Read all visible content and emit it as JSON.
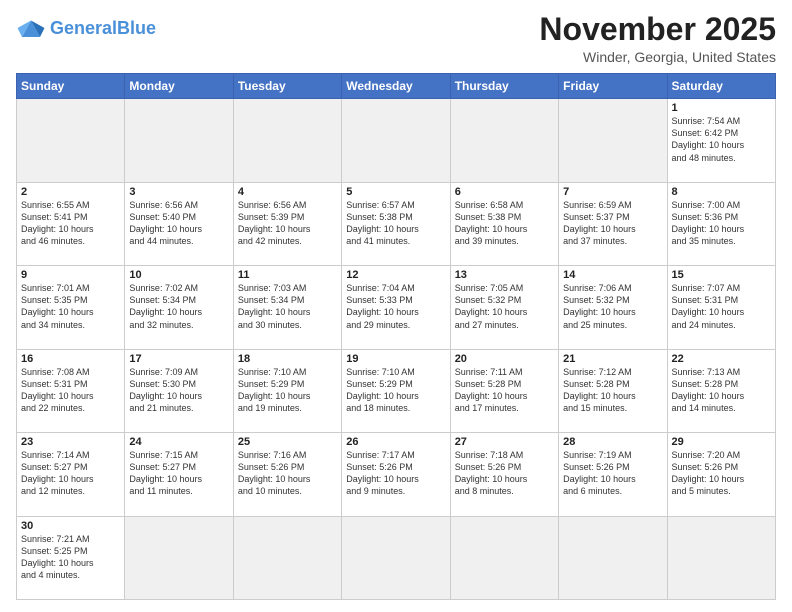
{
  "header": {
    "logo_general": "General",
    "logo_blue": "Blue",
    "month": "November 2025",
    "location": "Winder, Georgia, United States"
  },
  "weekdays": [
    "Sunday",
    "Monday",
    "Tuesday",
    "Wednesday",
    "Thursday",
    "Friday",
    "Saturday"
  ],
  "weeks": [
    [
      {
        "day": "",
        "info": ""
      },
      {
        "day": "",
        "info": ""
      },
      {
        "day": "",
        "info": ""
      },
      {
        "day": "",
        "info": ""
      },
      {
        "day": "",
        "info": ""
      },
      {
        "day": "",
        "info": ""
      },
      {
        "day": "1",
        "info": "Sunrise: 7:54 AM\nSunset: 6:42 PM\nDaylight: 10 hours\nand 48 minutes."
      }
    ],
    [
      {
        "day": "2",
        "info": "Sunrise: 6:55 AM\nSunset: 5:41 PM\nDaylight: 10 hours\nand 46 minutes."
      },
      {
        "day": "3",
        "info": "Sunrise: 6:56 AM\nSunset: 5:40 PM\nDaylight: 10 hours\nand 44 minutes."
      },
      {
        "day": "4",
        "info": "Sunrise: 6:56 AM\nSunset: 5:39 PM\nDaylight: 10 hours\nand 42 minutes."
      },
      {
        "day": "5",
        "info": "Sunrise: 6:57 AM\nSunset: 5:38 PM\nDaylight: 10 hours\nand 41 minutes."
      },
      {
        "day": "6",
        "info": "Sunrise: 6:58 AM\nSunset: 5:38 PM\nDaylight: 10 hours\nand 39 minutes."
      },
      {
        "day": "7",
        "info": "Sunrise: 6:59 AM\nSunset: 5:37 PM\nDaylight: 10 hours\nand 37 minutes."
      },
      {
        "day": "8",
        "info": "Sunrise: 7:00 AM\nSunset: 5:36 PM\nDaylight: 10 hours\nand 35 minutes."
      }
    ],
    [
      {
        "day": "9",
        "info": "Sunrise: 7:01 AM\nSunset: 5:35 PM\nDaylight: 10 hours\nand 34 minutes."
      },
      {
        "day": "10",
        "info": "Sunrise: 7:02 AM\nSunset: 5:34 PM\nDaylight: 10 hours\nand 32 minutes."
      },
      {
        "day": "11",
        "info": "Sunrise: 7:03 AM\nSunset: 5:34 PM\nDaylight: 10 hours\nand 30 minutes."
      },
      {
        "day": "12",
        "info": "Sunrise: 7:04 AM\nSunset: 5:33 PM\nDaylight: 10 hours\nand 29 minutes."
      },
      {
        "day": "13",
        "info": "Sunrise: 7:05 AM\nSunset: 5:32 PM\nDaylight: 10 hours\nand 27 minutes."
      },
      {
        "day": "14",
        "info": "Sunrise: 7:06 AM\nSunset: 5:32 PM\nDaylight: 10 hours\nand 25 minutes."
      },
      {
        "day": "15",
        "info": "Sunrise: 7:07 AM\nSunset: 5:31 PM\nDaylight: 10 hours\nand 24 minutes."
      }
    ],
    [
      {
        "day": "16",
        "info": "Sunrise: 7:08 AM\nSunset: 5:31 PM\nDaylight: 10 hours\nand 22 minutes."
      },
      {
        "day": "17",
        "info": "Sunrise: 7:09 AM\nSunset: 5:30 PM\nDaylight: 10 hours\nand 21 minutes."
      },
      {
        "day": "18",
        "info": "Sunrise: 7:10 AM\nSunset: 5:29 PM\nDaylight: 10 hours\nand 19 minutes."
      },
      {
        "day": "19",
        "info": "Sunrise: 7:10 AM\nSunset: 5:29 PM\nDaylight: 10 hours\nand 18 minutes."
      },
      {
        "day": "20",
        "info": "Sunrise: 7:11 AM\nSunset: 5:28 PM\nDaylight: 10 hours\nand 17 minutes."
      },
      {
        "day": "21",
        "info": "Sunrise: 7:12 AM\nSunset: 5:28 PM\nDaylight: 10 hours\nand 15 minutes."
      },
      {
        "day": "22",
        "info": "Sunrise: 7:13 AM\nSunset: 5:28 PM\nDaylight: 10 hours\nand 14 minutes."
      }
    ],
    [
      {
        "day": "23",
        "info": "Sunrise: 7:14 AM\nSunset: 5:27 PM\nDaylight: 10 hours\nand 12 minutes."
      },
      {
        "day": "24",
        "info": "Sunrise: 7:15 AM\nSunset: 5:27 PM\nDaylight: 10 hours\nand 11 minutes."
      },
      {
        "day": "25",
        "info": "Sunrise: 7:16 AM\nSunset: 5:26 PM\nDaylight: 10 hours\nand 10 minutes."
      },
      {
        "day": "26",
        "info": "Sunrise: 7:17 AM\nSunset: 5:26 PM\nDaylight: 10 hours\nand 9 minutes."
      },
      {
        "day": "27",
        "info": "Sunrise: 7:18 AM\nSunset: 5:26 PM\nDaylight: 10 hours\nand 8 minutes."
      },
      {
        "day": "28",
        "info": "Sunrise: 7:19 AM\nSunset: 5:26 PM\nDaylight: 10 hours\nand 6 minutes."
      },
      {
        "day": "29",
        "info": "Sunrise: 7:20 AM\nSunset: 5:26 PM\nDaylight: 10 hours\nand 5 minutes."
      }
    ],
    [
      {
        "day": "30",
        "info": "Sunrise: 7:21 AM\nSunset: 5:25 PM\nDaylight: 10 hours\nand 4 minutes."
      },
      {
        "day": "",
        "info": ""
      },
      {
        "day": "",
        "info": ""
      },
      {
        "day": "",
        "info": ""
      },
      {
        "day": "",
        "info": ""
      },
      {
        "day": "",
        "info": ""
      },
      {
        "day": "",
        "info": ""
      }
    ]
  ]
}
